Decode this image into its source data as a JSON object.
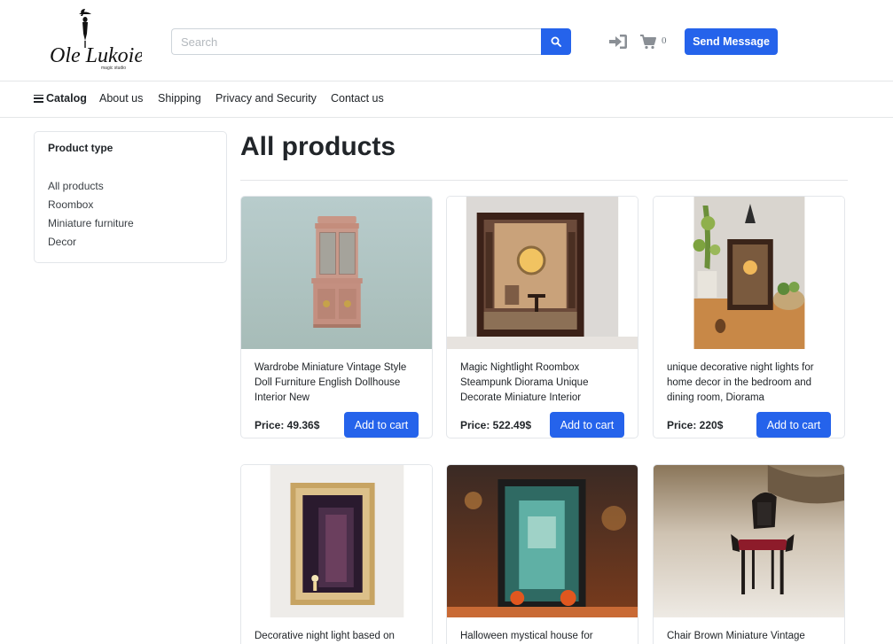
{
  "header": {
    "logo_text": "Ole Lukoie",
    "logo_sub": "magic studio",
    "search_placeholder": "Search",
    "cart_count": "0",
    "send_message_label": "Send Message"
  },
  "nav": {
    "catalog": "Catalog",
    "items": [
      "About us",
      "Shipping",
      "Privacy and Security",
      "Contact us"
    ]
  },
  "sidebar": {
    "title": "Product type",
    "links": [
      "All products",
      "Roombox",
      "Miniature furniture",
      "Decor"
    ]
  },
  "main": {
    "title": "All products",
    "add_to_cart_label": "Add to cart",
    "products": [
      {
        "title": "Wardrobe Miniature Vintage Style Doll Furniture English Dollhouse Interior New",
        "price": "Price: 49.36$"
      },
      {
        "title": "Magic Nightlight Roombox Steampunk Diorama Unique Decorate Miniature Interior",
        "price": "Price: 522.49$"
      },
      {
        "title": "unique decorative night lights for home decor in the bedroom and dining room, Diorama",
        "price": "Price: 220$"
      },
      {
        "title": "Decorative night light based on"
      },
      {
        "title": "Halloween mystical house for"
      },
      {
        "title": "Chair Brown Miniature Vintage"
      }
    ]
  },
  "colors": {
    "primary": "#2563eb",
    "border": "#e3e6ea",
    "text": "#212529"
  }
}
